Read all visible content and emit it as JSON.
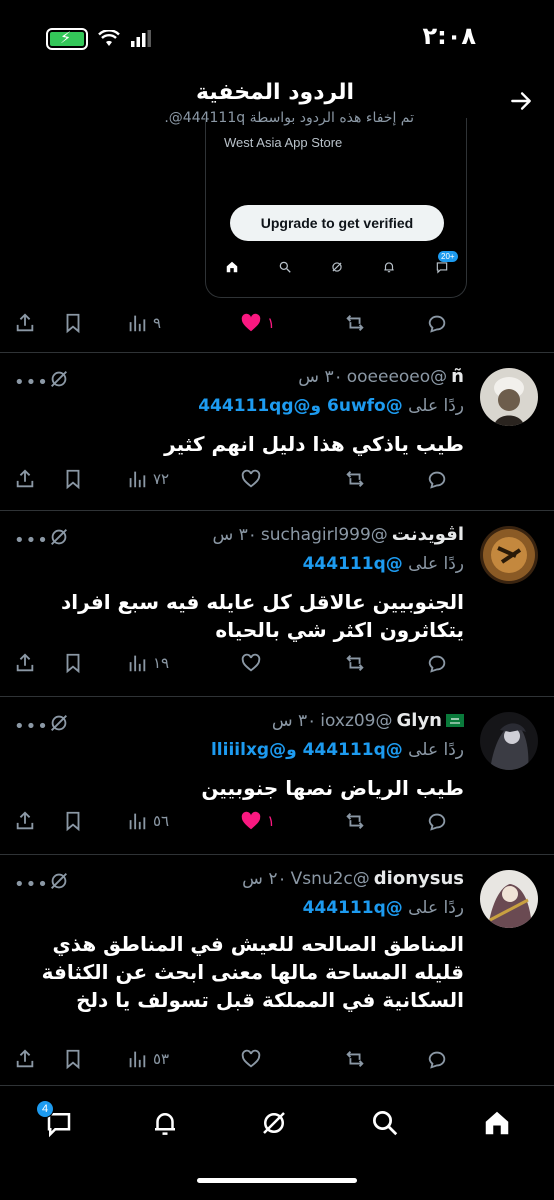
{
  "status_bar": {
    "time": "٢:٠٨"
  },
  "header": {
    "title": "الردود المخفية",
    "subtitle": "تم إخفاء هذه الردود بواسطة 444111q@."
  },
  "embedded_card": {
    "store_text": "West Asia App Store",
    "upgrade_button": "Upgrade to get verified",
    "nav_badge": "20+"
  },
  "top_actions": {
    "views": "٩",
    "likes": "١",
    "liked": true
  },
  "tweets": [
    {
      "name": "ñ",
      "handle": "@ooeeeoeo",
      "time": "٣٠ س",
      "reply_prefix": "ردًا على",
      "mentions": "@6uwfo و@444111qg",
      "text": "طيب ياذكي هذا دليل انهم كثير",
      "views": "٧٢",
      "likes": "",
      "liked": false
    },
    {
      "name": "اڤويدنت",
      "handle": "@suchagirl999",
      "time": "٣٠ س",
      "reply_prefix": "ردًا على",
      "mentions": "@444111q",
      "text": "الجنوبيين عالاقل كل عايله فيه سبع افراد يتكاثرون اكثر شي بالحياه",
      "views": "١٩",
      "likes": "",
      "liked": false
    },
    {
      "name": "Glyn",
      "handle": "@ioxz09",
      "time": "٣٠ س",
      "reply_prefix": "ردًا على",
      "mentions": "@444111q و@lliiilxg",
      "text": "طيب الرياض نصها جنوبيين",
      "views": "٥٦",
      "likes": "١",
      "liked": true
    },
    {
      "name": "dionysus",
      "handle": "@Vsnu2c",
      "time": "٢٠ س",
      "reply_prefix": "ردًا على",
      "mentions": "@444111q",
      "text": "المناطق الصالحه للعيش في المناطق هذي قليله المساحة مالها معنى ابحث عن الكثافة السكانية في المملكة قبل تسولف يا دلخ",
      "views": "٥٣",
      "likes": "",
      "liked": false
    }
  ],
  "bottom_nav": {
    "messages_badge": "4"
  },
  "colors": {
    "accent": "#1d9bf0",
    "like": "#f91880",
    "muted": "#8b98a5",
    "divider": "#2f3336"
  },
  "icons": [
    "share-icon",
    "bookmark-icon",
    "views-icon",
    "heart-icon",
    "retweet-icon",
    "reply-icon",
    "more-icon",
    "grok-icon",
    "home-icon",
    "search-icon",
    "notifications-icon",
    "messages-icon",
    "back-arrow-icon"
  ]
}
